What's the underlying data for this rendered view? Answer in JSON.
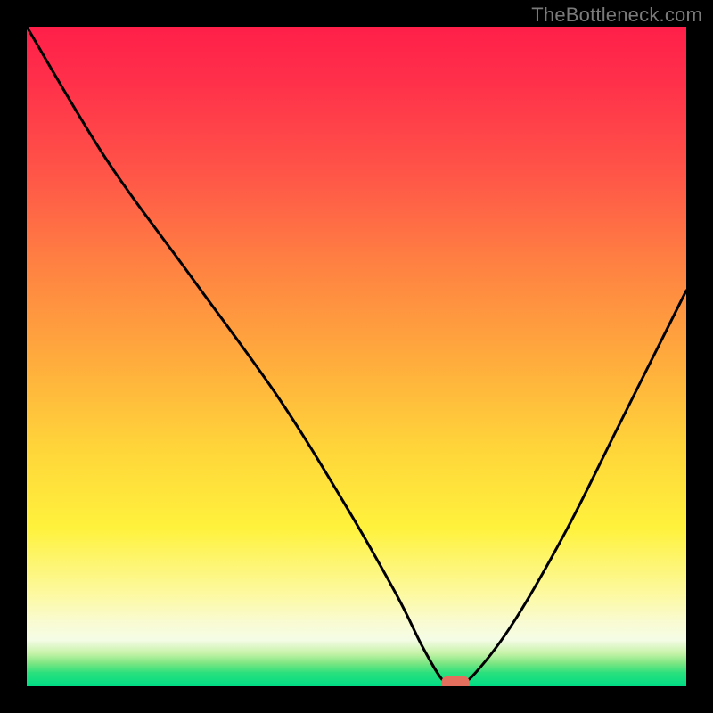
{
  "attribution": "TheBottleneck.com",
  "chart_data": {
    "type": "line",
    "title": "",
    "xlabel": "",
    "ylabel": "",
    "xlim": [
      0,
      100
    ],
    "ylim": [
      0,
      100
    ],
    "x": [
      0,
      12,
      25,
      38,
      48,
      56,
      60,
      63,
      65,
      68,
      74,
      82,
      90,
      100
    ],
    "values": [
      100,
      80,
      62,
      44,
      28,
      14,
      6,
      1,
      0,
      2,
      10,
      24,
      40,
      60
    ],
    "minimum": {
      "x": 65,
      "y": 0
    },
    "background_gradient": {
      "top_color": "#ff1f49",
      "mid_color": "#ffd53a",
      "bottom_color": "#00dc85"
    },
    "marker_color": "#e46e5e"
  }
}
